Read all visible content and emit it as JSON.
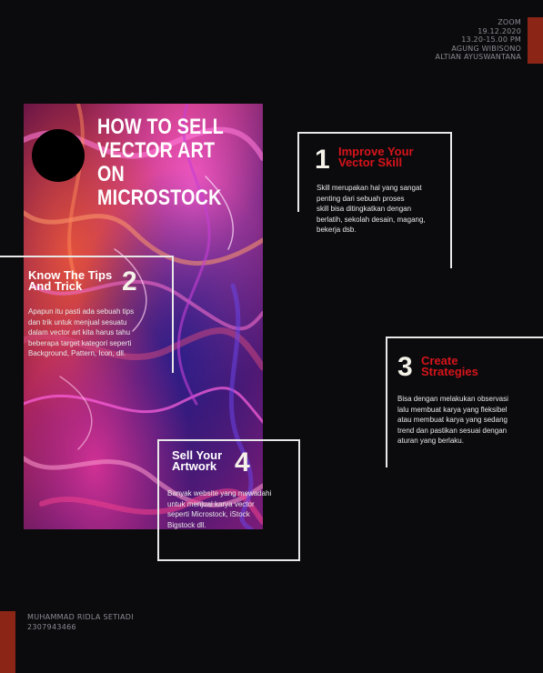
{
  "meta": {
    "event": "ZOOM",
    "date": "19.12.2020",
    "time": "13.20-15.00 PM",
    "speaker1": "AGUNG WIBISONO",
    "speaker2": "ALTIAN AYUSWANTANA"
  },
  "author": {
    "name": "MUHAMMAD RIDLA SETIADI",
    "id": "2307943466"
  },
  "poster": {
    "title_line1": "HOW TO SELL",
    "title_line2": "VECTOR ART",
    "title_line3": "ON MICROSTOCK"
  },
  "steps": [
    {
      "number": "1",
      "title_line1": "Improve Your",
      "title_line2": "Vector Skill",
      "body_line1": "Skill merupakan hal yang sangat",
      "body_line2": "penting dari sebuah proses",
      "body_line3": "skill bisa ditingkatkan dengan",
      "body_line4": "berlatih, sekolah desain, magang,",
      "body_line5": "bekerja dsb."
    },
    {
      "number": "2",
      "title_line1": "Know The Tips",
      "title_line2": "And Trick",
      "body_line1": "Apapun itu pasti ada sebuah tips",
      "body_line2": "dan trik untuk menjual sesuatu",
      "body_line3": "dalam vector art kita harus tahu",
      "body_line4": "beberapa target kategori seperti",
      "body_line5": "Background, Pattern, Icon, dll."
    },
    {
      "number": "3",
      "title_line1": "Create",
      "title_line2": "Strategies",
      "body_line1": "Bisa dengan melakukan observasi",
      "body_line2": "lalu membuat karya yang fleksibel",
      "body_line3": "atau membuat karya yang sedang",
      "body_line4": "trend dan pastikan sesuai dengan",
      "body_line5": "aturan yang berlaku."
    },
    {
      "number": "4",
      "title_line1": "Sell Your",
      "title_line2": "Artwork",
      "body_line1": "Banyak website yang mewadahi",
      "body_line2": "untuk menjual karya vector",
      "body_line3": "seperti Microstock, iStock",
      "body_line4": "Bigstock dll."
    }
  ],
  "colors": {
    "background": "#0b0b0e",
    "accent_red": "#d6141a",
    "bar_red": "#8b2516",
    "frame": "#e8e8e8"
  }
}
